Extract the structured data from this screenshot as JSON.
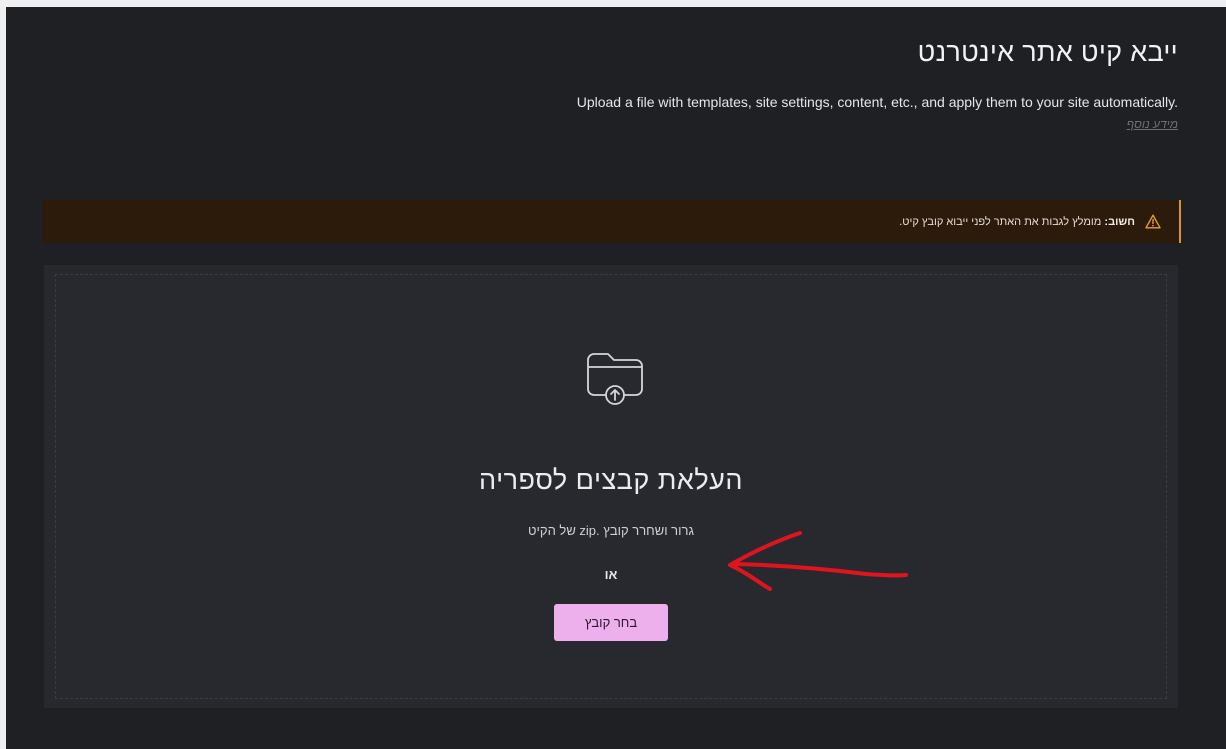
{
  "header": {
    "title": "ייבא קיט אתר אינטרנט",
    "subtitle": "Upload a file with templates, site settings, content, etc., and apply them to your site automatically.",
    "learn_more": "מידע נוסף"
  },
  "notice": {
    "icon": "warning-icon",
    "strong": "חשוב:",
    "text": " מומלץ לגבות את האתר לפני ייבוא קובץ קיט."
  },
  "upload": {
    "icon": "folder-upload-icon",
    "title": "העלאת קבצים לספריה",
    "hint": "גרור ושחרר קובץ .zip של הקיט",
    "or": "או",
    "button_label": "בחר קובץ"
  },
  "annotation": {
    "type": "red-hand-drawn-arrow",
    "color": "#e0141e"
  },
  "colors": {
    "background": "#1f2024",
    "panel": "#28292e",
    "notice_bg": "#2c1a0b",
    "notice_accent": "#d8962a",
    "button": "#eeb0ec"
  }
}
